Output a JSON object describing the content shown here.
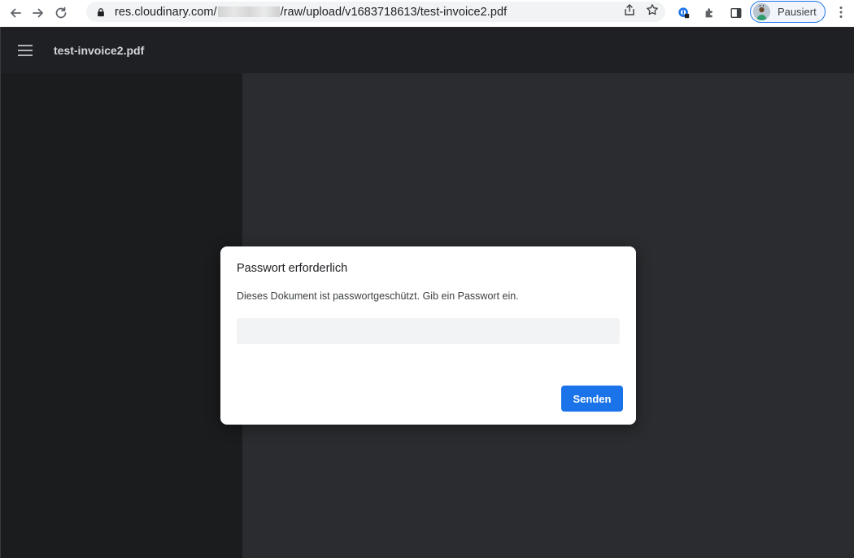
{
  "browser": {
    "url_prefix": "res.cloudinary.com/",
    "url_suffix": "/raw/upload/v1683718613/test-invoice2.pdf",
    "profile_label": "Pausiert",
    "icons": {
      "back": "arrow-left-icon",
      "forward": "arrow-right-icon",
      "reload": "reload-icon",
      "lock": "lock-icon",
      "share": "share-icon",
      "bookmark": "star-icon",
      "extension_1": "password-manager-icon",
      "extensions": "puzzle-icon",
      "side_panel": "side-panel-icon",
      "menu": "kebab-menu-icon"
    },
    "accent_color": "#1a73e8"
  },
  "viewer": {
    "doc_title": "test-invoice2.pdf",
    "menu_icon": "hamburger-icon"
  },
  "dialog": {
    "title": "Passwort erforderlich",
    "message": "Dieses Dokument ist passwortgeschützt. Gib ein Passwort ein.",
    "password_value": "",
    "submit_label": "Senden"
  }
}
